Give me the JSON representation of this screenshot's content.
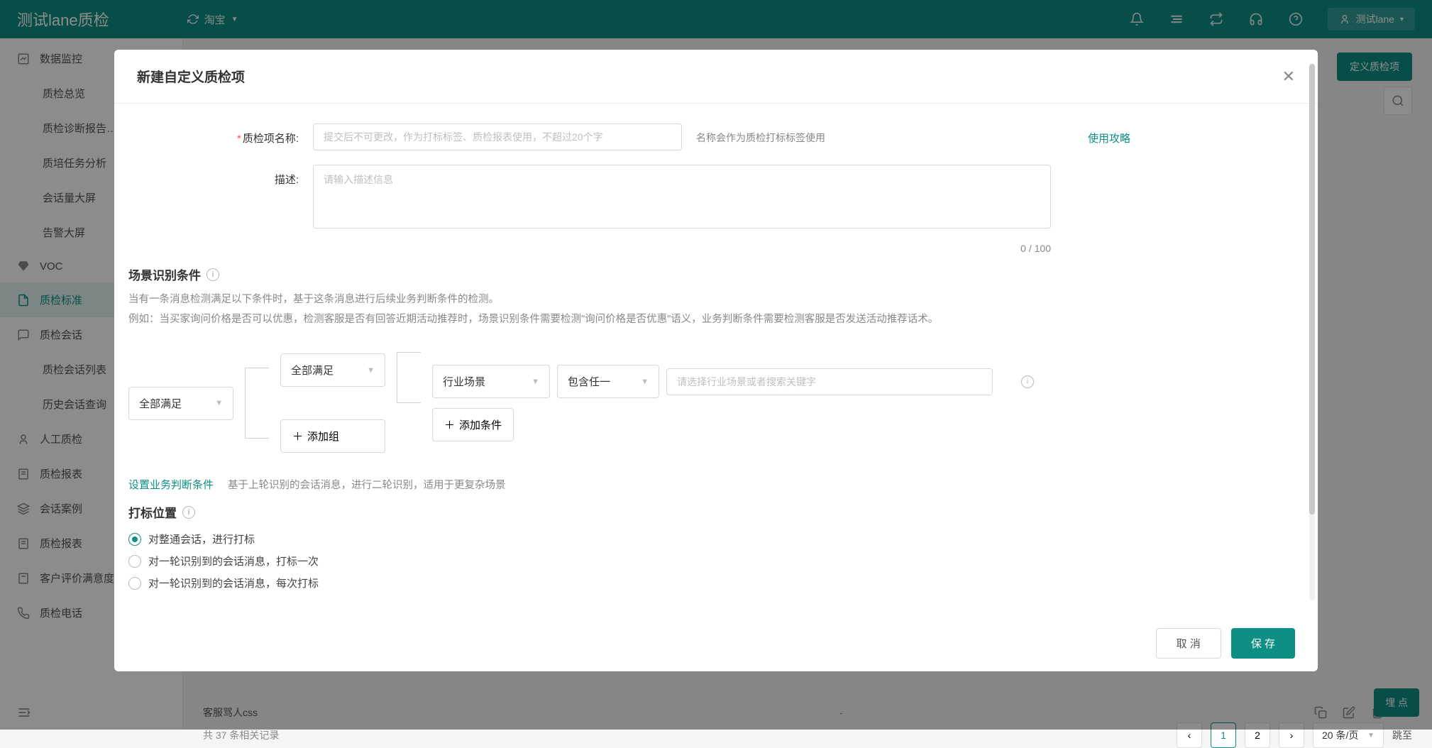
{
  "header": {
    "brand": "测试lane质检",
    "shop": "淘宝",
    "user": "测试lane"
  },
  "sidebar": {
    "items": [
      {
        "label": "数据监控",
        "type": "parent"
      },
      {
        "label": "质检总览",
        "type": "child"
      },
      {
        "label": "质检诊断报告…",
        "type": "child"
      },
      {
        "label": "质培任务分析",
        "type": "child"
      },
      {
        "label": "会话量大屏",
        "type": "child"
      },
      {
        "label": "告警大屏",
        "type": "child"
      },
      {
        "label": "VOC",
        "type": "parent"
      },
      {
        "label": "质检标准",
        "type": "parent",
        "active": true
      },
      {
        "label": "质检会话",
        "type": "parent"
      },
      {
        "label": "质检会话列表",
        "type": "child",
        "badge": true
      },
      {
        "label": "历史会话查询",
        "type": "child"
      },
      {
        "label": "人工质检",
        "type": "parent"
      },
      {
        "label": "质检报表",
        "type": "parent"
      },
      {
        "label": "会话案例",
        "type": "parent"
      },
      {
        "label": "质检报表",
        "type": "parent"
      },
      {
        "label": "客户评价满意度",
        "type": "parent"
      },
      {
        "label": "质检电话",
        "type": "parent",
        "arrow": true
      }
    ]
  },
  "main": {
    "create_btn": "定义质检项",
    "row_sample_name": "客服骂人css",
    "row_sample_dash": "-",
    "records": "共 37 条相关记录",
    "pager": {
      "page1": "1",
      "page2": "2",
      "size": "20 条/页",
      "jump": "跳至"
    }
  },
  "float_btn": "埋 点",
  "modal": {
    "title": "新建自定义质检项",
    "name_label": "质检项名称:",
    "name_placeholder": "提交后不可更改，作为打标标签、质检报表使用，不超过20个字",
    "name_help": "名称会作为质检打标标签使用",
    "guide": "使用攻略",
    "desc_label": "描述:",
    "desc_placeholder": "请输入描述信息",
    "counter": "0 / 100",
    "scene_title": "场景识别条件",
    "scene_sub1": "当有一条消息检测满足以下条件时，基于这条消息进行后续业务判断条件的检测。",
    "scene_sub2": "例如：当买家询问价格是否可以优惠，检测客服是否有回答近期活动推荐时，场景识别条件需要检测\"询问价格是否优惠\"语义，业务判断条件需要检测客服是否发送活动推荐话术。",
    "sel_all1": "全部满足",
    "sel_all2": "全部满足",
    "sel_industry": "行业场景",
    "sel_any": "包含任一",
    "scene_placeholder": "请选择行业场景或者搜索关键字",
    "add_cond": "添加条件",
    "add_group": "添加组",
    "action_link": "设置业务判断条件",
    "action_desc": "基于上轮识别的会话消息，进行二轮识别，适用于更复杂场景",
    "mark_title": "打标位置",
    "radio1": "对整通会话，进行打标",
    "radio2": "对一轮识别到的会话消息，打标一次",
    "radio3": "对一轮识别到的会话消息，每次打标",
    "cancel": "取 消",
    "save": "保 存"
  }
}
